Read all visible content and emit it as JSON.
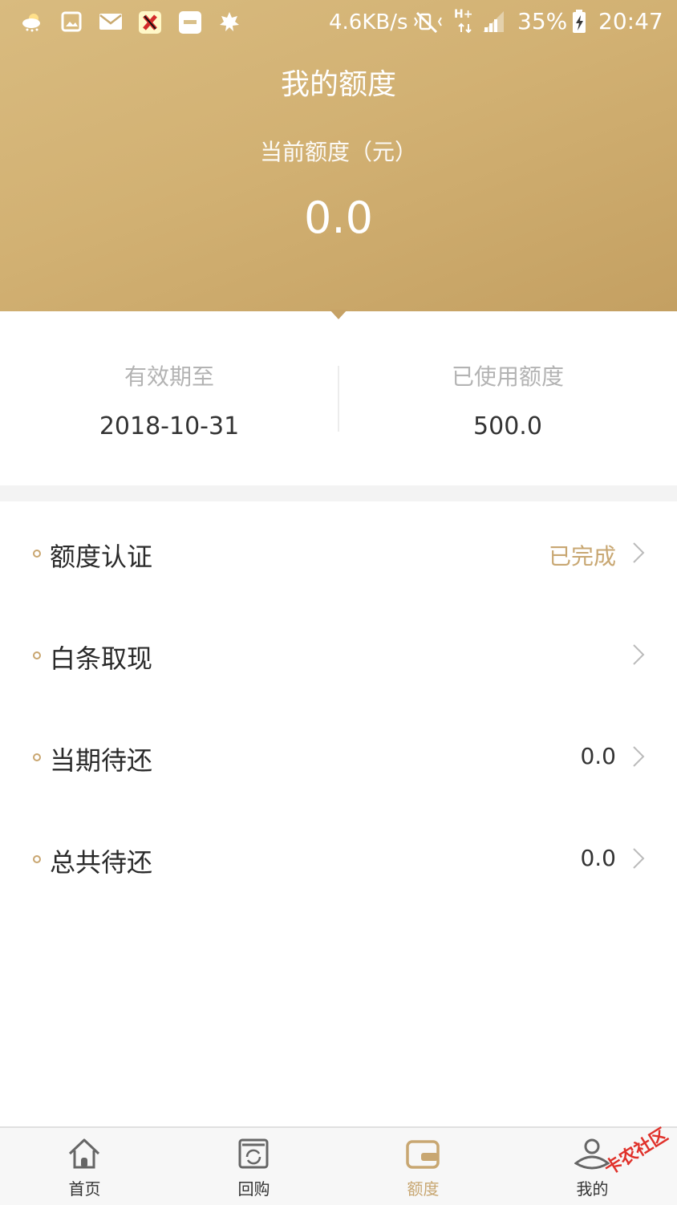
{
  "status_bar": {
    "net_speed": "4.6KB/s",
    "network": "H+",
    "battery": "35%",
    "time": "20:47"
  },
  "header": {
    "title": "我的额度",
    "subtitle": "当前额度（元）",
    "amount": "0.0"
  },
  "info": {
    "expiry_label": "有效期至",
    "expiry_value": "2018-10-31",
    "used_label": "已使用额度",
    "used_value": "500.0"
  },
  "menu": [
    {
      "label": "额度认证",
      "value": "已完成"
    },
    {
      "label": "白条取现",
      "value": ""
    },
    {
      "label": "当期待还",
      "value": "0.0"
    },
    {
      "label": "总共待还",
      "value": "0.0"
    }
  ],
  "tabbar": [
    {
      "label": "首页",
      "icon": "home-icon"
    },
    {
      "label": "回购",
      "icon": "buyback-icon"
    },
    {
      "label": "额度",
      "icon": "wallet-icon",
      "active": true
    },
    {
      "label": "我的",
      "icon": "profile-icon"
    }
  ],
  "watermark": "卡农社区",
  "colors": {
    "accent": "#c8a772",
    "header_start": "#d9bb7f",
    "header_end": "#c4a062"
  }
}
